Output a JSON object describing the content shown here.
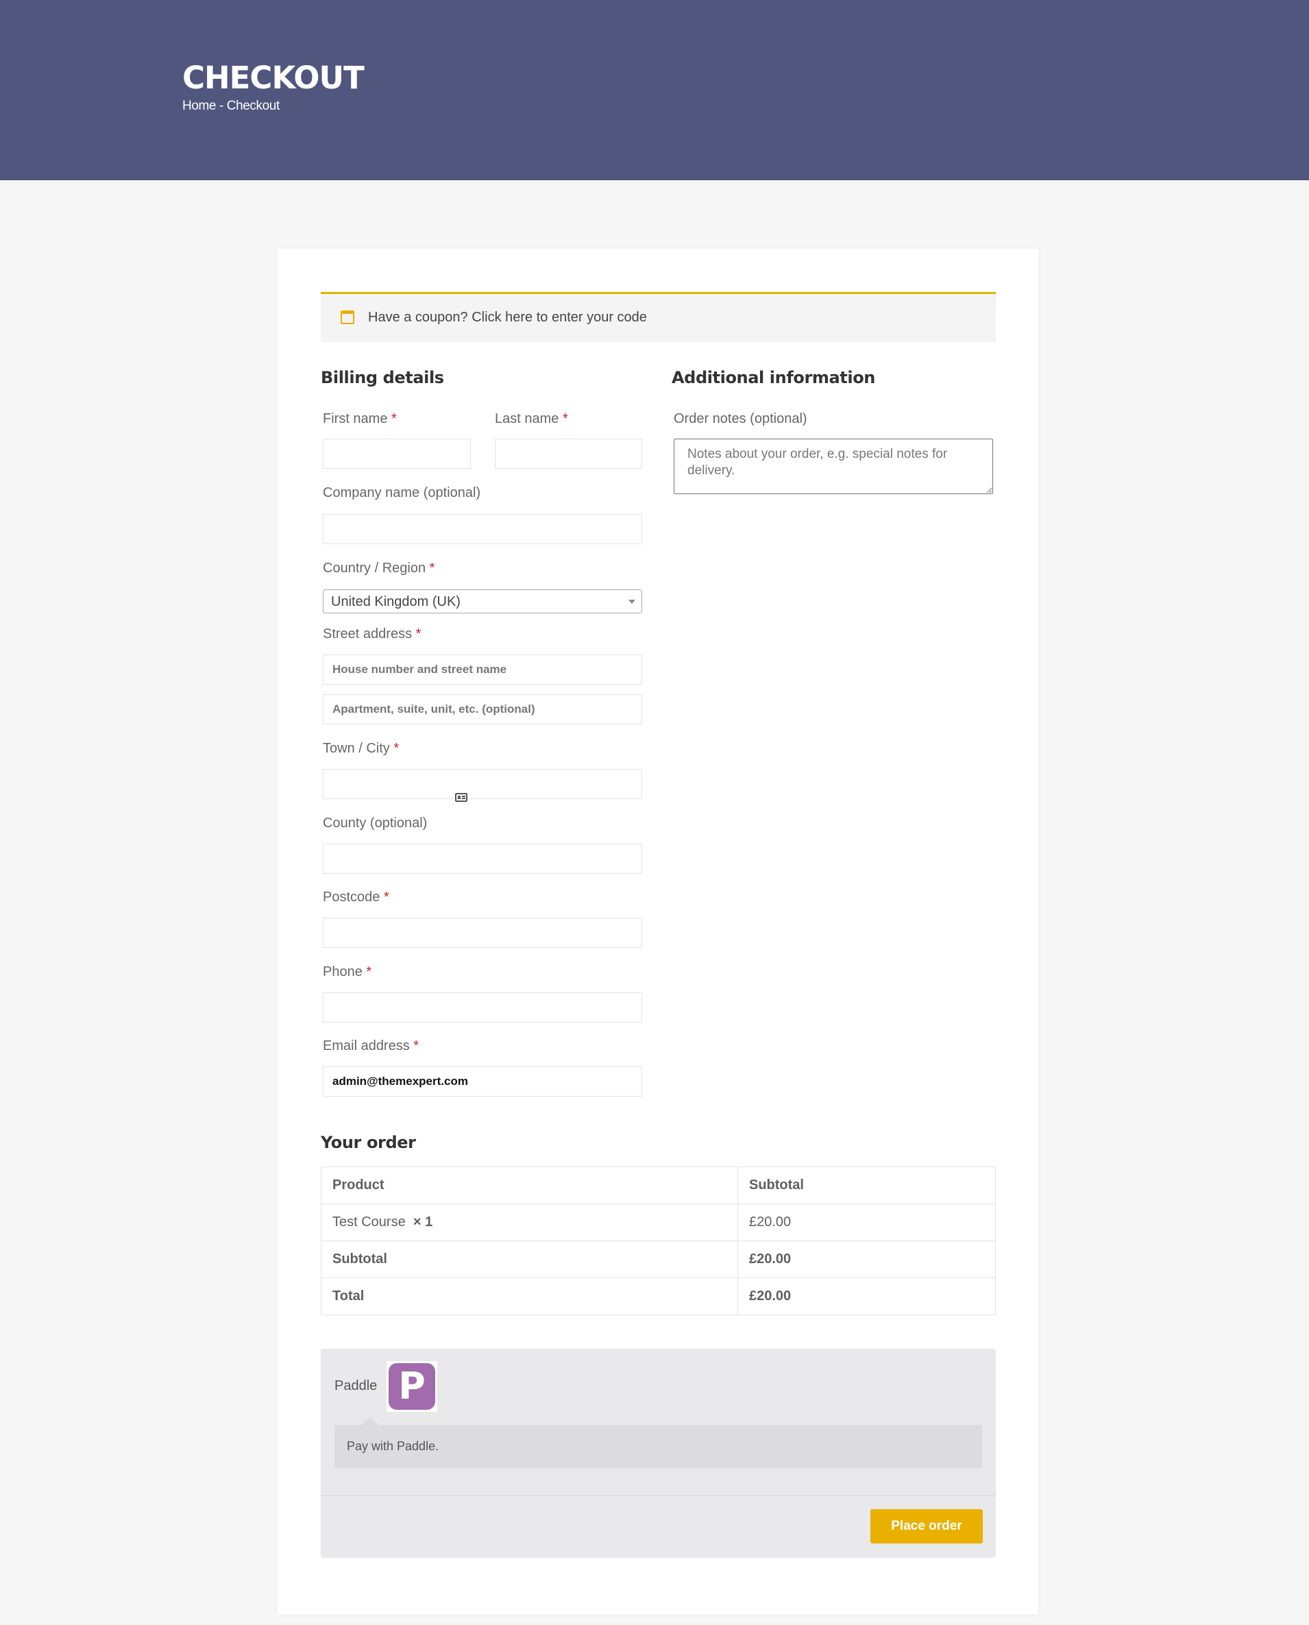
{
  "header": {
    "title": "CHECKOUT",
    "breadcrumb": {
      "home": "Home",
      "separator": " - ",
      "current": "Checkout"
    }
  },
  "coupon": {
    "text": "Have a coupon?",
    "link": "Click here to enter your code"
  },
  "billing": {
    "title": "Billing details",
    "required_mark": "*",
    "first_name_label": "First name",
    "last_name_label": "Last name",
    "company_label": "Company name (optional)",
    "country_label": "Country / Region",
    "country_value": "United Kingdom (UK)",
    "street_label": "Street address",
    "street_placeholder_1": "House number and street name",
    "street_placeholder_2": "Apartment, suite, unit, etc. (optional)",
    "city_label": "Town / City",
    "county_label": "County (optional)",
    "postcode_label": "Postcode",
    "phone_label": "Phone",
    "email_label": "Email address",
    "email_value": "admin@themexpert.com"
  },
  "additional": {
    "title": "Additional information",
    "notes_label": "Order notes (optional)",
    "notes_placeholder": "Notes about your order, e.g. special notes for delivery."
  },
  "order": {
    "title": "Your order",
    "headers": [
      "Product",
      "Subtotal"
    ],
    "item": {
      "name": "Test Course",
      "qty": "× 1",
      "price": "£20.00"
    },
    "subtotal_label": "Subtotal",
    "subtotal_value": "£20.00",
    "total_label": "Total",
    "total_value": "£20.00"
  },
  "payment": {
    "method": "Paddle",
    "logo_letter": "P",
    "description": "Pay with Paddle.",
    "button": "Place order"
  },
  "colors": {
    "header_bg": "#50567e",
    "accent": "#e9b000",
    "required": "#d01f1f",
    "paddle": "#a16bad"
  }
}
